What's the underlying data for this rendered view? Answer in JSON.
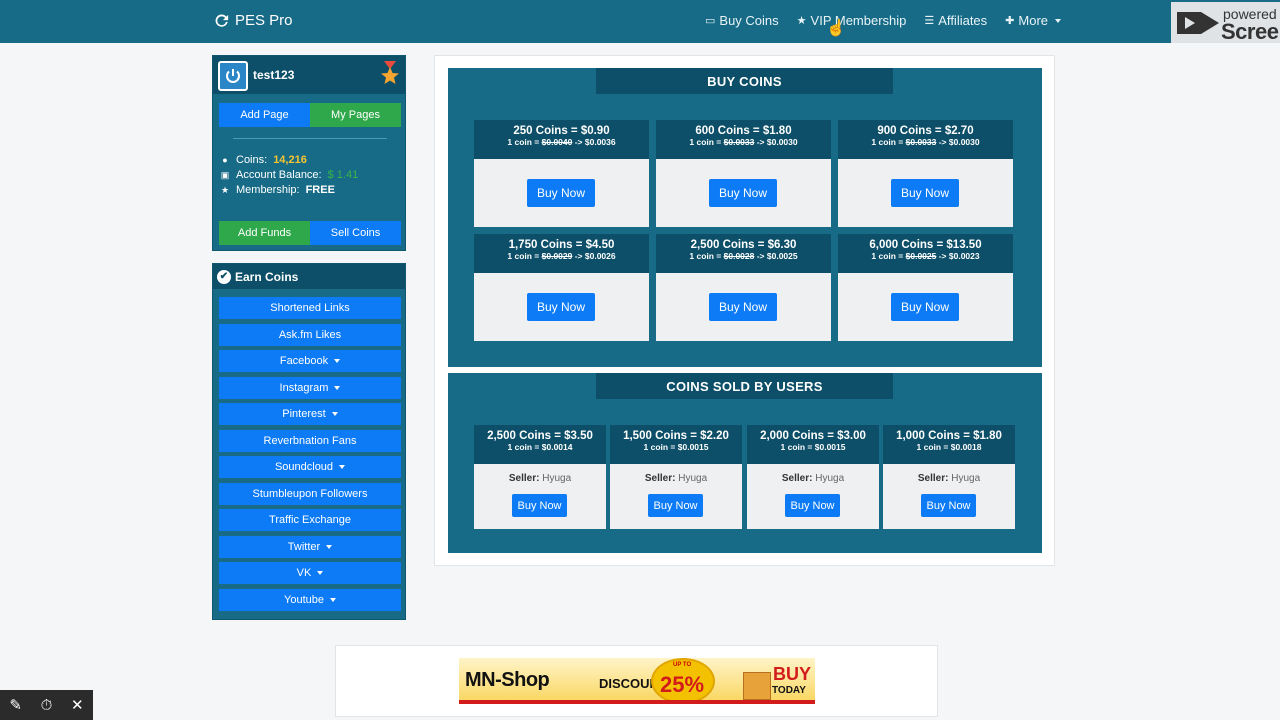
{
  "nav": {
    "brand": "PES Pro",
    "links": [
      {
        "icon": "card-icon",
        "label": "Buy Coins"
      },
      {
        "icon": "star-icon",
        "label": "VIP Membership"
      },
      {
        "icon": "list-icon",
        "label": "Affiliates"
      },
      {
        "icon": "plus-icon",
        "label": "More"
      }
    ]
  },
  "watermark": {
    "line1": "powered",
    "line2": "Scree"
  },
  "user": {
    "name": "test123",
    "add_page": "Add Page",
    "my_pages": "My Pages",
    "coins_label": "Coins:",
    "coins_value": "14,216",
    "balance_label": "Account Balance:",
    "balance_value": "$ 1.41",
    "membership_label": "Membership:",
    "membership_value": "FREE",
    "add_funds": "Add Funds",
    "sell_coins": "Sell Coins"
  },
  "earn": {
    "title": "Earn Coins",
    "items": [
      {
        "label": "Shortened Links",
        "dropdown": false
      },
      {
        "label": "Ask.fm Likes",
        "dropdown": false
      },
      {
        "label": "Facebook",
        "dropdown": true
      },
      {
        "label": "Instagram",
        "dropdown": true
      },
      {
        "label": "Pinterest",
        "dropdown": true
      },
      {
        "label": "Reverbnation Fans",
        "dropdown": false
      },
      {
        "label": "Soundcloud",
        "dropdown": true
      },
      {
        "label": "Stumbleupon Followers",
        "dropdown": false
      },
      {
        "label": "Traffic Exchange",
        "dropdown": false
      },
      {
        "label": "Twitter",
        "dropdown": true
      },
      {
        "label": "VK",
        "dropdown": true
      },
      {
        "label": "Youtube",
        "dropdown": true
      }
    ]
  },
  "buy_coins": {
    "title": "BUY COINS",
    "button": "Buy Now",
    "packages": [
      {
        "title": "250 Coins = $0.90",
        "rate_prefix": "1 coin = ",
        "old": "$0.0040",
        "new": " -> $0.0036"
      },
      {
        "title": "600 Coins = $1.80",
        "rate_prefix": "1 coin = ",
        "old": "$0.0033",
        "new": " -> $0.0030"
      },
      {
        "title": "900 Coins = $2.70",
        "rate_prefix": "1 coin = ",
        "old": "$0.0033",
        "new": " -> $0.0030"
      },
      {
        "title": "1,750 Coins = $4.50",
        "rate_prefix": "1 coin = ",
        "old": "$0.0029",
        "new": " -> $0.0026"
      },
      {
        "title": "2,500 Coins = $6.30",
        "rate_prefix": "1 coin = ",
        "old": "$0.0028",
        "new": " -> $0.0025"
      },
      {
        "title": "6,000 Coins = $13.50",
        "rate_prefix": "1 coin = ",
        "old": "$0.0025",
        "new": " -> $0.0023"
      }
    ]
  },
  "sold_by_users": {
    "title": "COINS SOLD BY USERS",
    "button": "Buy Now",
    "seller_label": "Seller:",
    "offers": [
      {
        "title": "2,500 Coins = $3.50",
        "rate": "1 coin = $0.0014",
        "seller": "Hyuga"
      },
      {
        "title": "1,500 Coins = $2.20",
        "rate": "1 coin = $0.0015",
        "seller": "Hyuga"
      },
      {
        "title": "2,000 Coins = $3.00",
        "rate": "1 coin = $0.0015",
        "seller": "Hyuga"
      },
      {
        "title": "1,000 Coins = $1.80",
        "rate": "1 coin = $0.0018",
        "seller": "Hyuga"
      }
    ]
  },
  "ad": {
    "shop": "MN-Shop",
    "discount": "DISCOUNT",
    "upto": "UP TO",
    "percent": "25%",
    "buy": "BUY",
    "today": "TODAY"
  },
  "colors": {
    "nav": "#176b87",
    "panel": "#176b87",
    "panel_dark": "#0d4f68",
    "primary": "#0d7bf5",
    "success": "#2ea84a",
    "coins": "#f7c531"
  }
}
